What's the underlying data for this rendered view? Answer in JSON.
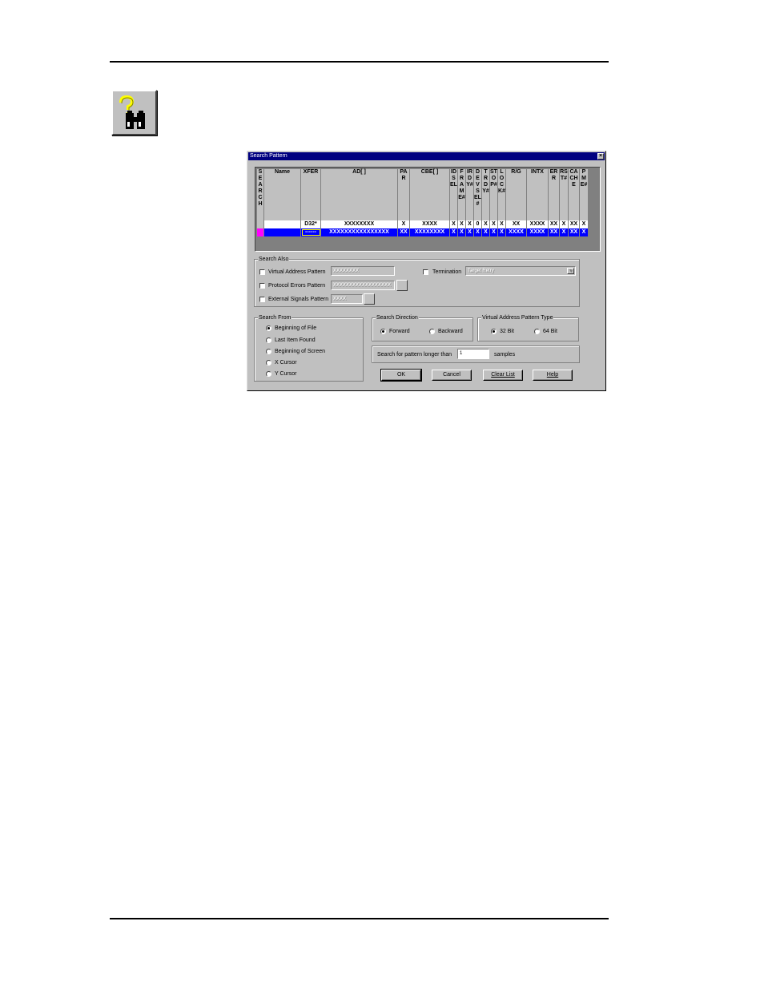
{
  "dialog": {
    "title": "Search Pattern",
    "close_glyph": "×"
  },
  "grid": {
    "columns": [
      {
        "key": "search",
        "label": "SEARCH"
      },
      {
        "key": "name",
        "label": "Name"
      },
      {
        "key": "xfer",
        "label": "XFER"
      },
      {
        "key": "ad",
        "label": "AD[ ]"
      },
      {
        "key": "par",
        "label": "PAR"
      },
      {
        "key": "cbe",
        "label": "CBE[ ]"
      },
      {
        "key": "idsel",
        "label": "IDSEL"
      },
      {
        "key": "frame",
        "label": "FRAME#"
      },
      {
        "key": "irdy",
        "label": "IRDY#"
      },
      {
        "key": "devsel",
        "label": "DEVSEL#"
      },
      {
        "key": "trdy",
        "label": "TRDY#"
      },
      {
        "key": "stop",
        "label": "STOP#"
      },
      {
        "key": "lock",
        "label": "LOCK#"
      },
      {
        "key": "rg",
        "label": "R/G"
      },
      {
        "key": "intx",
        "label": "INTX"
      },
      {
        "key": "err",
        "label": "ERR"
      },
      {
        "key": "rst",
        "label": "RST#"
      },
      {
        "key": "cache",
        "label": "CACHE"
      },
      {
        "key": "pme",
        "label": "PME#"
      }
    ],
    "rows": [
      [
        "",
        "",
        "D32*",
        "XXXXXXXX",
        "X",
        "XXXX",
        "X",
        "X",
        "X",
        "0",
        "X",
        "X",
        "X",
        "XX",
        "XXXX",
        "XX",
        "X",
        "XX",
        "X"
      ],
      [
        "",
        "",
        "------",
        "XXXXXXXXXXXXXXXX",
        "XX",
        "XXXXXXXX",
        "X",
        "X",
        "X",
        "X",
        "X",
        "X",
        "X",
        "XXXX",
        "XXXX",
        "XX",
        "X",
        "XX",
        "X"
      ]
    ]
  },
  "search_also": {
    "title": "Search Also",
    "virtual_address_label": "Virtual Address Pattern",
    "virtual_address_value": "XXXXXXXX",
    "protocol_errors_label": "Protocol  Errors Pattern",
    "protocol_errors_value": "XXXXXXXXXXXXXXXXXX",
    "external_signals_label": "External Signals Pattern",
    "external_signals_value": "XXXX",
    "termination_label": "Termination",
    "termination_value": "Target Retry"
  },
  "search_from": {
    "title": "Search From",
    "options": [
      "Beginning of File",
      "Last Item Found",
      "Beginning of Screen",
      "X Cursor",
      "Y Cursor"
    ],
    "selected": 0
  },
  "search_direction": {
    "title": "Search Direction",
    "forward": "Forward",
    "backward": "Backward"
  },
  "va_type": {
    "title": "Virtual Address Pattern Type",
    "bit32": "32 Bit",
    "bit64": "64 Bit"
  },
  "longer": {
    "label": "Search for pattern longer than",
    "value": "1",
    "unit": "samples"
  },
  "buttons": {
    "ok": "OK",
    "cancel": "Cancel",
    "clear": "Clear List",
    "help": "Help"
  }
}
